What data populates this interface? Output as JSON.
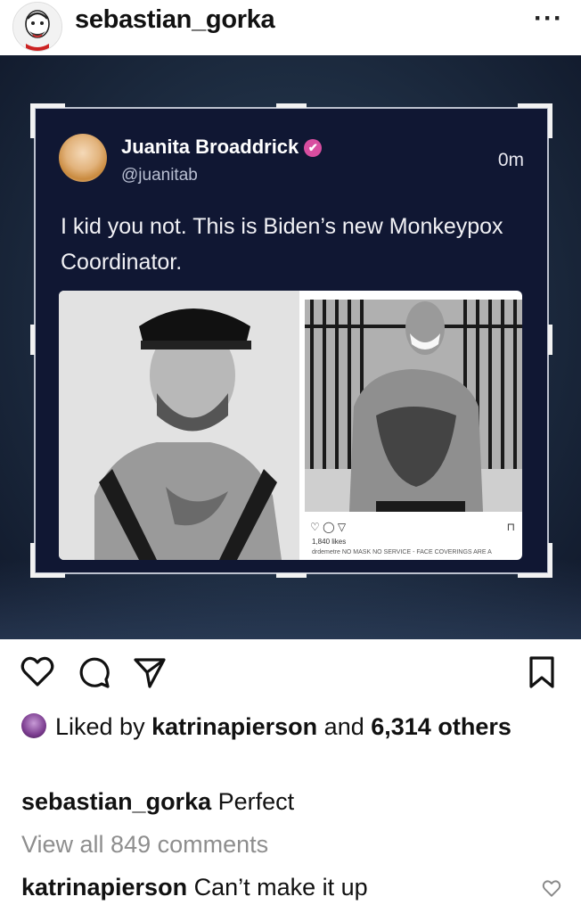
{
  "post": {
    "username": "sebastian_gorka",
    "more_label": "···"
  },
  "tweet": {
    "name": "Juanita Broaddrick",
    "verified_glyph": "✔",
    "handle": "@juanitab",
    "time": "0m",
    "text": "I kid you not. This is Biden’s new Monkeypox Coordinator.",
    "embedded_likes": "1,840 likes",
    "embedded_caption": "drdemetre NO MASK NO SERVICE - FACE COVERINGS ARE A"
  },
  "actions": {
    "like_icon": "heart-icon",
    "comment_icon": "comment-icon",
    "share_icon": "send-icon",
    "save_icon": "bookmark-icon"
  },
  "likes": {
    "prefix": "Liked by",
    "user": "katrinapierson",
    "middle": "and",
    "count": "6,314",
    "suffix": "others"
  },
  "caption": {
    "username": "sebastian_gorka",
    "text": "Perfect"
  },
  "comments": {
    "view_all": "View all 849 comments",
    "items": [
      {
        "username": "katrinapierson",
        "text": "Can’t make it up"
      }
    ]
  },
  "colors": {
    "verified": "#d84ea0",
    "tweet_bg": "#101733",
    "muted_text": "#8e8e8e"
  }
}
